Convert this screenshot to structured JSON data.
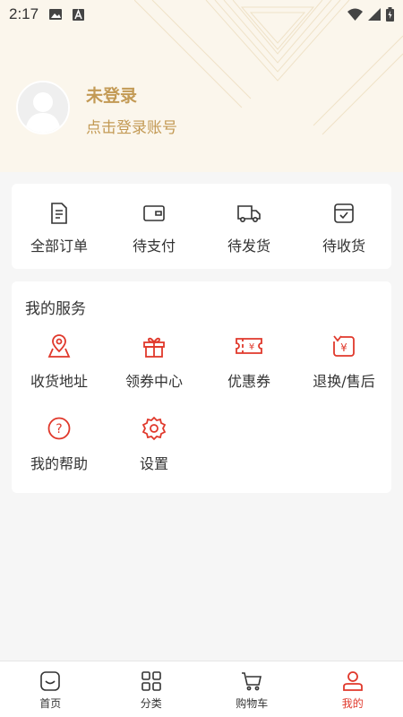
{
  "status_bar": {
    "time": "2:17"
  },
  "profile": {
    "title": "未登录",
    "subtitle": "点击登录账号"
  },
  "orders": [
    {
      "label": "全部订单",
      "icon": "document-icon"
    },
    {
      "label": "待支付",
      "icon": "wallet-icon"
    },
    {
      "label": "待发货",
      "icon": "truck-icon"
    },
    {
      "label": "待收货",
      "icon": "box-check-icon"
    }
  ],
  "services": {
    "title": "我的服务",
    "items": [
      {
        "label": "收货地址",
        "icon": "map-pin-icon"
      },
      {
        "label": "领券中心",
        "icon": "gift-icon"
      },
      {
        "label": "优惠券",
        "icon": "coupon-icon"
      },
      {
        "label": "退换/售后",
        "icon": "refund-icon"
      },
      {
        "label": "我的帮助",
        "icon": "help-icon"
      },
      {
        "label": "设置",
        "icon": "gear-icon"
      }
    ]
  },
  "tabbar": [
    {
      "label": "首页",
      "icon": "home-icon"
    },
    {
      "label": "分类",
      "icon": "grid-icon"
    },
    {
      "label": "购物车",
      "icon": "cart-icon"
    },
    {
      "label": "我的",
      "icon": "user-icon",
      "active": true
    }
  ],
  "colors": {
    "accent": "#e0382b",
    "gold": "#c39a55",
    "header_bg": "#fbf6ec"
  }
}
